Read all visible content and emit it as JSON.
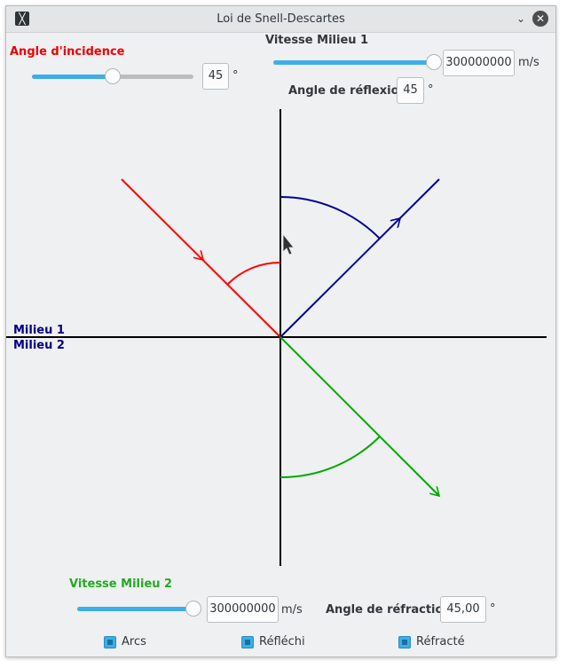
{
  "window": {
    "title": "Loi de Snell-Descartes",
    "icon_glyph": "╳"
  },
  "incidence": {
    "label": "Angle d'incidence",
    "value": "45",
    "unit": "°",
    "slider_fraction": 0.5
  },
  "speed1": {
    "label": "Vitesse Milieu 1",
    "value": "300000000",
    "unit": "m/s",
    "slider_fraction": 1.0
  },
  "reflection": {
    "label": "Angle de réflexion",
    "value": "45",
    "unit": "°"
  },
  "media": {
    "medium1": "Milieu 1",
    "medium2": "Milieu 2"
  },
  "speed2": {
    "label": "Vitesse Milieu 2",
    "value": "300000000",
    "unit": "m/s",
    "slider_fraction": 1.0
  },
  "refraction": {
    "label": "Angle de réfraction",
    "value": "45,00",
    "unit": "°"
  },
  "options": [
    {
      "label": "Arcs",
      "checked": true
    },
    {
      "label": "Réfléchi",
      "checked": true
    },
    {
      "label": "Réfracté",
      "checked": true
    }
  ],
  "colors": {
    "incident": "#ff0000",
    "reflected": "#000099",
    "refracted": "#00aa00",
    "accent": "#3daee9"
  }
}
